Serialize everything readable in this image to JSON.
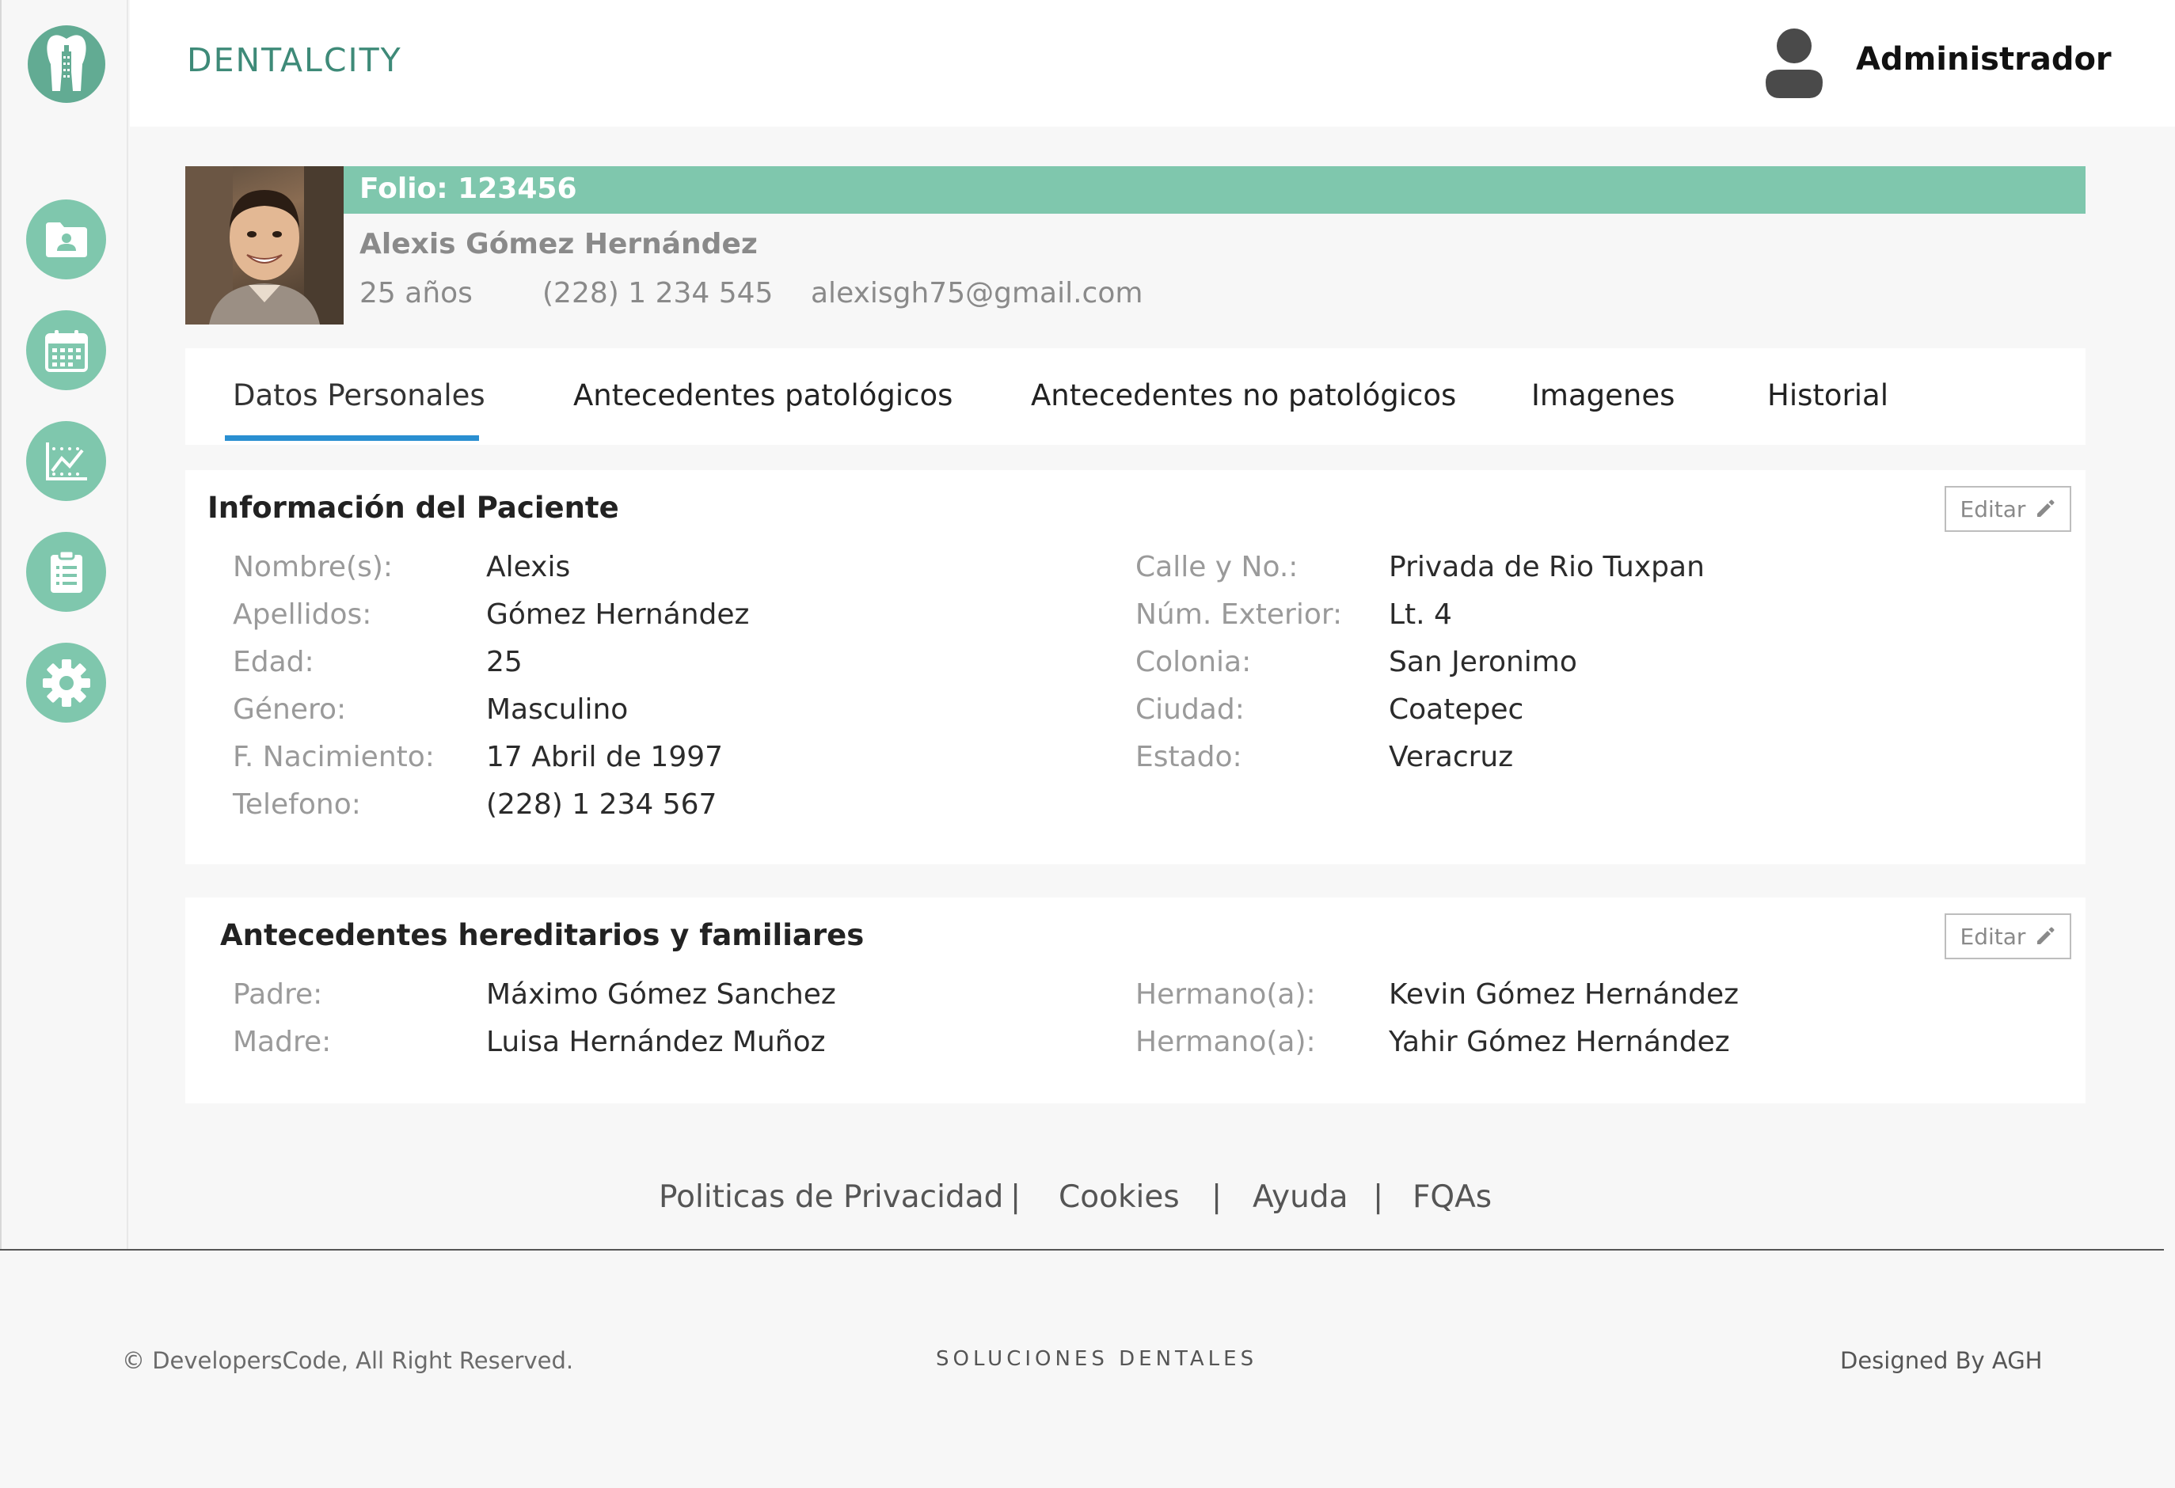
{
  "app": {
    "brand": "DENTALCITY",
    "user": "Administrador"
  },
  "patient": {
    "folio": "Folio: 123456",
    "name": "Alexis Gómez Hernández",
    "age": "25 años",
    "phone": "(228) 1 234 545",
    "email": "alexisgh75@gmail.com"
  },
  "tabs": [
    {
      "label": "Datos Personales",
      "active": true
    },
    {
      "label": "Antecedentes patológicos"
    },
    {
      "label": "Antecedentes no patológicos"
    },
    {
      "label": "Imagenes"
    },
    {
      "label": "Historial"
    }
  ],
  "info_card": {
    "title": "Información del Paciente",
    "edit_label": "Editar",
    "left": [
      {
        "label": "Nombre(s):",
        "value": "Alexis"
      },
      {
        "label": "Apellidos:",
        "value": "Gómez Hernández"
      },
      {
        "label": "Edad:",
        "value": "25"
      },
      {
        "label": "Género:",
        "value": "Masculino"
      },
      {
        "label": "F. Nacimiento:",
        "value": "17 Abril de 1997"
      },
      {
        "label": "Telefono:",
        "value": "(228) 1 234 567"
      }
    ],
    "right": [
      {
        "label": "Calle y No.:",
        "value": "Privada de Rio Tuxpan"
      },
      {
        "label": "Núm. Exterior:",
        "value": "Lt. 4"
      },
      {
        "label": "Colonia:",
        "value": "San Jeronimo"
      },
      {
        "label": "Ciudad:",
        "value": "Coatepec"
      },
      {
        "label": "Estado:",
        "value": "Veracruz"
      }
    ]
  },
  "family_card": {
    "title": "Antecedentes hereditarios y familiares",
    "edit_label": "Editar",
    "left": [
      {
        "label": "Padre:",
        "value": "Máximo Gómez Sanchez"
      },
      {
        "label": "Madre:",
        "value": "Luisa Hernández Muñoz"
      }
    ],
    "right": [
      {
        "label": "Hermano(a):",
        "value": "Kevin Gómez Hernández"
      },
      {
        "label": "Hermano(a):",
        "value": "Yahir Gómez Hernández"
      }
    ]
  },
  "footer_links": {
    "privacy": "Politicas de Privacidad",
    "cookies": "Cookies",
    "help": "Ayuda",
    "faqs": "FQAs",
    "separator": "|"
  },
  "bottom": {
    "copyright": "© DevelopersCode, All Right Reserved.",
    "tagline": "SOLUCIONES DENTALES",
    "credit": "Designed By AGH"
  },
  "colors": {
    "accent": "#7fc7ad",
    "logo": "#62ab93",
    "brand_text": "#3e8a78",
    "tab_underline": "#2a8fd1"
  },
  "icons": [
    "tooth-logo-icon",
    "patient-folder-icon",
    "calendar-icon",
    "chart-icon",
    "clipboard-icon",
    "gear-icon",
    "user-icon",
    "pencil-icon"
  ]
}
